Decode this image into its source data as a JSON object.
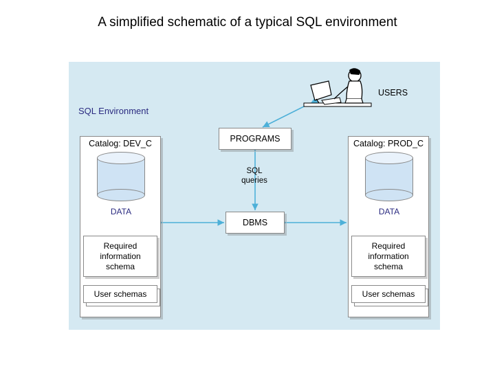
{
  "title": "A simplified schematic of a typical SQL environment",
  "env_label": "SQL Environment",
  "users_label": "USERS",
  "programs_label": "PROGRAMS",
  "dbms_label": "DBMS",
  "sql_queries_label": "SQL\nqueries",
  "catalog_left": {
    "title": "Catalog: DEV_C",
    "data_label": "DATA",
    "info_schema_label": "Required information schema",
    "user_schemas_label": "User schemas"
  },
  "catalog_right": {
    "title": "Catalog: PROD_C",
    "data_label": "DATA",
    "info_schema_label": "Required information schema",
    "user_schemas_label": "User schemas"
  }
}
